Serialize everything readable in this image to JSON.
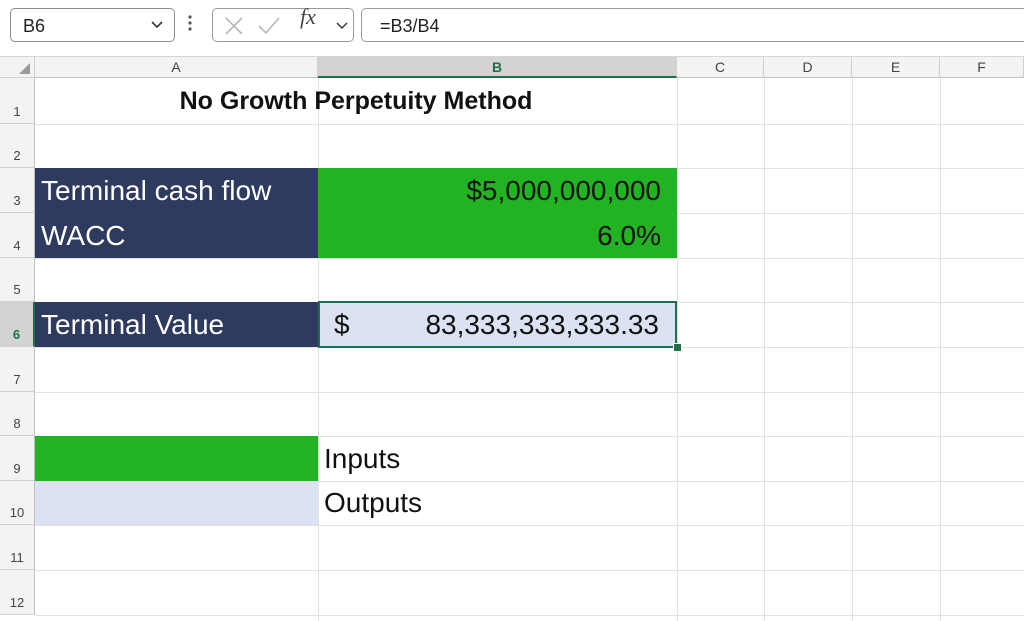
{
  "formula_bar": {
    "name_box": "B6",
    "fx_label": "fx",
    "formula": "=B3/B4"
  },
  "columns": [
    "A",
    "B",
    "C",
    "D",
    "E",
    "F"
  ],
  "rows": [
    "1",
    "2",
    "3",
    "4",
    "5",
    "6",
    "7",
    "8",
    "9",
    "10",
    "11",
    "12"
  ],
  "cells": {
    "A1": "No Growth Perpetuity Method",
    "A3": "Terminal cash flow",
    "B3": "$5,000,000,000",
    "A4": "WACC",
    "B4": "6.0%",
    "A6": "Terminal Value",
    "B6_currency": "$",
    "B6_value": "83,333,333,333.33",
    "B9": "Inputs",
    "B10": "Outputs"
  },
  "colors": {
    "input_fill": "#22b322",
    "label_fill": "#2e3b5f",
    "output_fill": "#dbe2f1",
    "selection": "#1e7145"
  }
}
